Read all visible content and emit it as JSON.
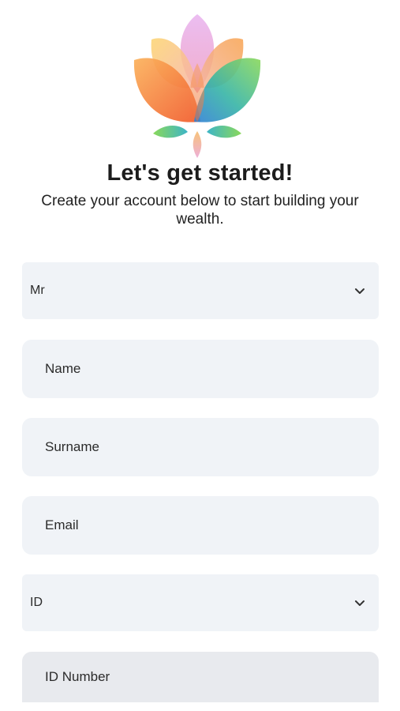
{
  "header": {
    "title": "Let's get started!",
    "subtitle": "Create your account below to start building your wealth."
  },
  "form": {
    "title_select": {
      "value": "Mr"
    },
    "name": {
      "placeholder": "Name",
      "value": ""
    },
    "surname": {
      "placeholder": "Surname",
      "value": ""
    },
    "email": {
      "placeholder": "Email",
      "value": ""
    },
    "id_type_select": {
      "value": "ID"
    },
    "id_number": {
      "placeholder": "ID Number",
      "value": ""
    }
  },
  "icons": {
    "logo": "lotus-logo-icon",
    "dropdown": "chevron-down-icon"
  },
  "colors": {
    "field_background": "#f0f3f7",
    "disabled_field_background": "#e8eaee",
    "text": "#1c1c1c"
  }
}
